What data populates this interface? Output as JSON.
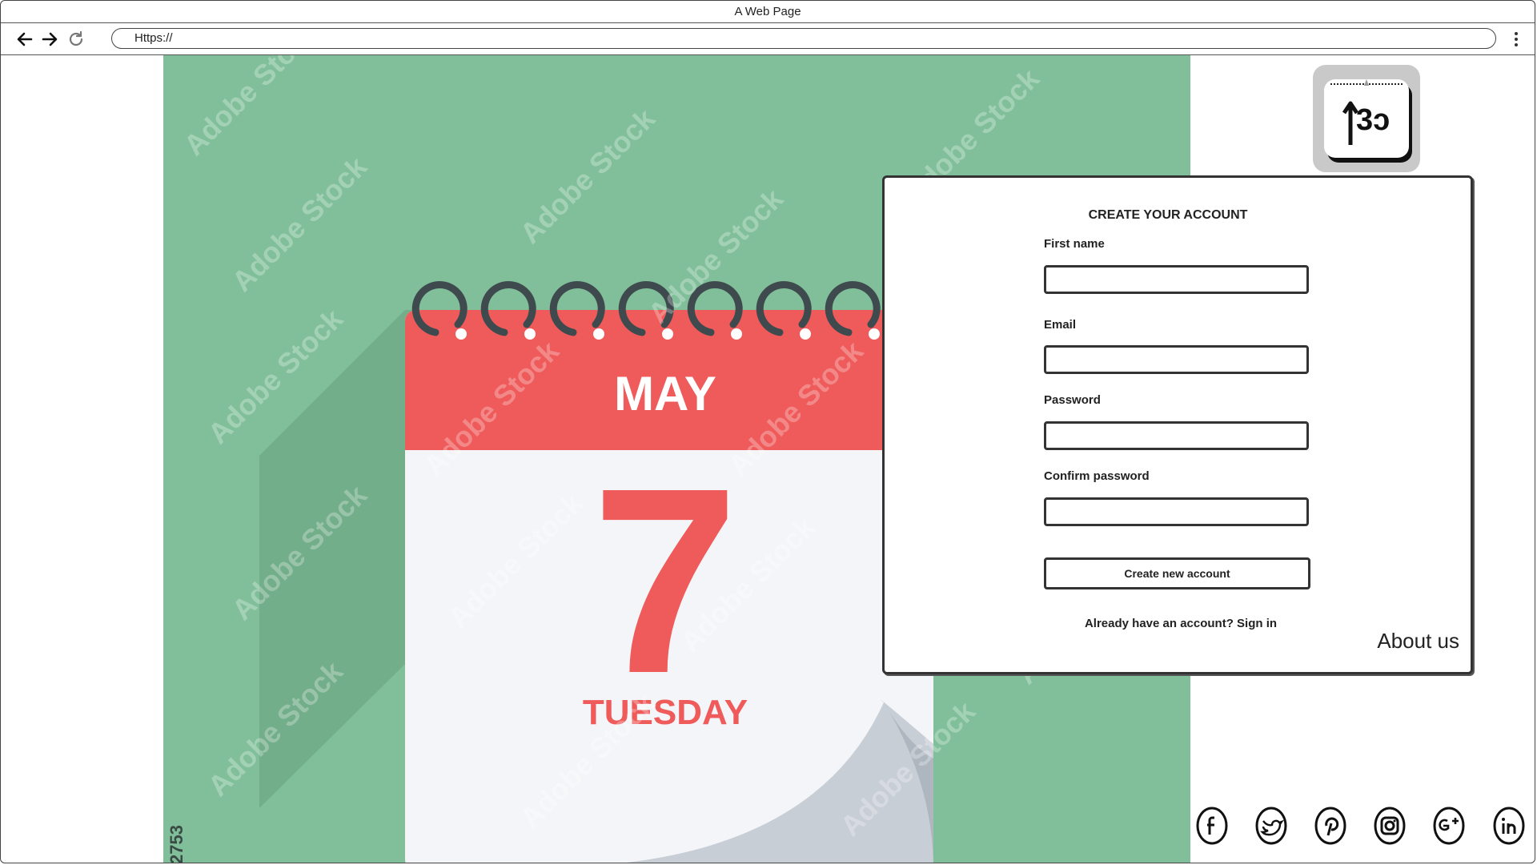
{
  "window": {
    "title": "A Web Page"
  },
  "toolbar": {
    "url": "Https://"
  },
  "hero": {
    "month": "MAY",
    "day": "7",
    "weekday": "TUESDAY",
    "watermark": "Adobe Stock",
    "stock_id_fragment": "2753"
  },
  "logo": {
    "text": "3ɔ"
  },
  "signup": {
    "title": "CREATE YOUR ACCOUNT",
    "fields": [
      {
        "label": "First name",
        "value": ""
      },
      {
        "label": "Email",
        "value": ""
      },
      {
        "label": "Password",
        "value": ""
      },
      {
        "label": "Confirm password",
        "value": ""
      }
    ],
    "submit_label": "Create new account",
    "signin_text": "Already have an account? Sign in"
  },
  "about": {
    "label": "About us"
  },
  "social": [
    "facebook-icon",
    "twitter-icon",
    "pinterest-icon",
    "instagram-icon",
    "google-plus-icon",
    "linkedin-icon"
  ],
  "colors": {
    "hero_green": "#80bf99",
    "calendar_red": "#ef5b5b",
    "calendar_page": "#f4f5f8",
    "ring_gray": "#3f4a4e"
  }
}
